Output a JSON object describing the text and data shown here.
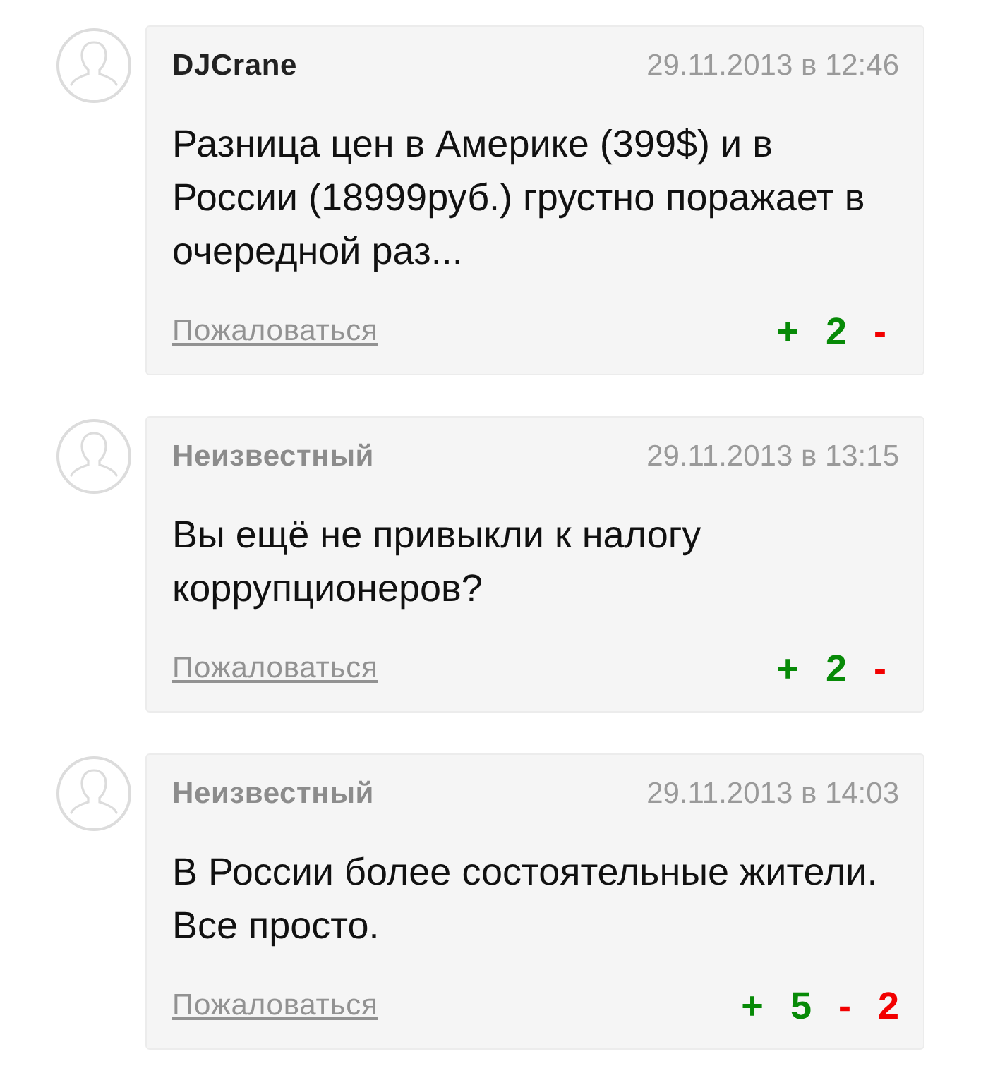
{
  "comments": [
    {
      "author": "DJCrane",
      "anonymous": false,
      "date": "29.11.2013 в 12:46",
      "text": "Разница цен в Америке (399$) и в России (18999руб.) грустно поражает в очередной раз...",
      "report": "Пожаловаться",
      "vote_up": "+",
      "up_count": "2",
      "vote_down": "-"
    },
    {
      "author": "Неизвестный",
      "anonymous": true,
      "date": "29.11.2013 в 13:15",
      "text": "Вы ещё не привыкли к налогу коррупционеров?",
      "report": "Пожаловаться",
      "vote_up": "+",
      "up_count": "2",
      "vote_down": "-"
    },
    {
      "author": "Неизвестный",
      "anonymous": true,
      "date": "29.11.2013 в 14:03",
      "text": "В России более состоятельные жители. Все просто.",
      "report": "Пожаловаться",
      "vote_up": "+",
      "up_count": "5",
      "vote_down": "-",
      "down_count": "2"
    }
  ]
}
